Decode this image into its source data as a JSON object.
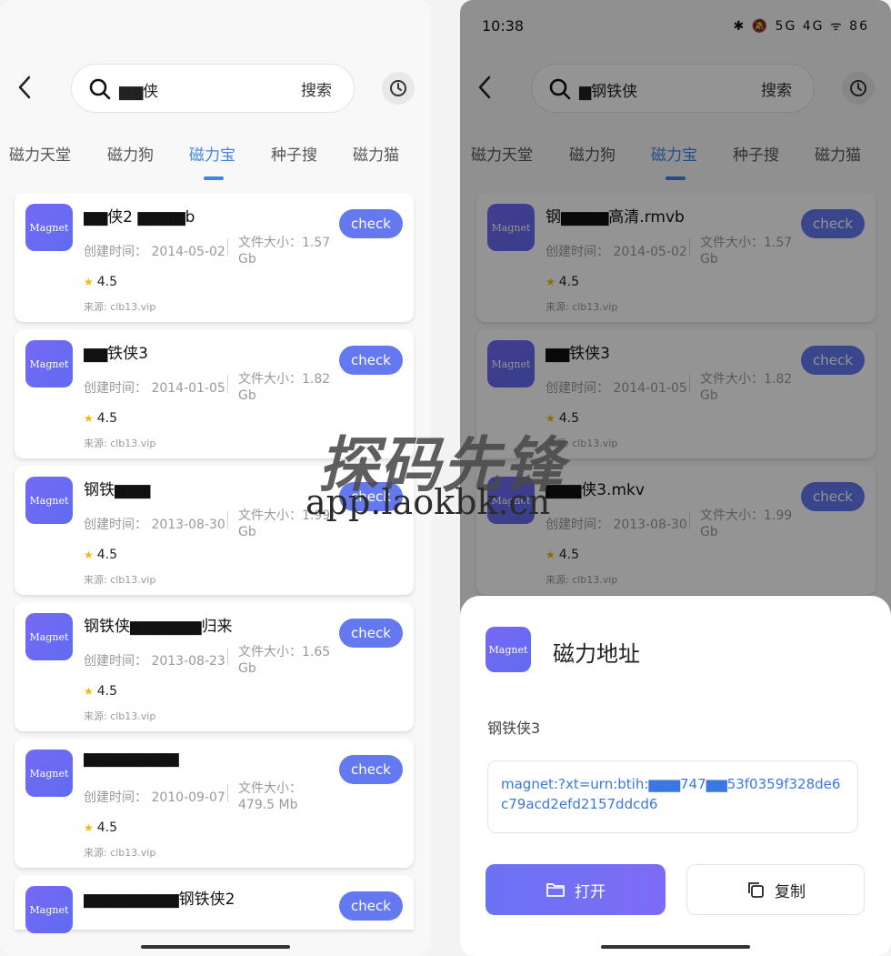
{
  "left": {
    "search": {
      "query": "▆▆侠",
      "button": "搜索"
    },
    "tabs": [
      "磁力天堂",
      "磁力狗",
      "磁力宝",
      "种子搜",
      "磁力猫"
    ],
    "active_tab": 2,
    "logo_text": "Magnet",
    "check_label": "check",
    "ctime_label": "创建时间：",
    "size_label": "文件大小：",
    "source_label": "来源: clb13.vip",
    "results": [
      {
        "title": "▆▆侠2 ▆▆▆▆b",
        "date": "2014-05-02",
        "size": "1.57 Gb",
        "rating": "4.5"
      },
      {
        "title": "▆▆铁侠3",
        "date": "2014-01-05",
        "size": "1.82 Gb",
        "rating": "4.5"
      },
      {
        "title": "钢铁▆▆▆",
        "date": "2013-08-30",
        "size": "1.99 Gb",
        "rating": "4.5"
      },
      {
        "title": "钢铁侠▆▆▆▆▆▆归来",
        "date": "2013-08-23",
        "size": "1.65 Gb",
        "rating": "4.5"
      },
      {
        "title": "▆▆▆▆▆▆▆▆",
        "date": "2010-09-07",
        "size": "479.5 Mb",
        "rating": "4.5"
      },
      {
        "title": "▆▆▆▆▆▆▆▆钢铁侠2"
      }
    ]
  },
  "right": {
    "status": {
      "time": "10:38",
      "icons": "✱ 🔕 5G 4G ᯤ 86"
    },
    "search": {
      "query": "▆钢铁侠",
      "button": "搜索"
    },
    "tabs": [
      "磁力天堂",
      "磁力狗",
      "磁力宝",
      "种子搜",
      "磁力猫"
    ],
    "active_tab": 2,
    "results": [
      {
        "title": "钢▆▆▆▆高清.rmvb",
        "date": "2014-05-02",
        "size": "1.57 Gb",
        "rating": "4.5"
      },
      {
        "title": "▆▆铁侠3",
        "date": "2014-01-05",
        "size": "1.82 Gb",
        "rating": "4.5"
      },
      {
        "title": "▆▆▆侠3.mkv",
        "date": "2013-08-30",
        "size": "1.99 Gb",
        "rating": "4.5"
      }
    ],
    "sheet": {
      "title": "磁力地址",
      "name": "钢铁侠3",
      "magnet": "magnet:?xt=urn:btih:▆▆▆747▆▆53f0359f328de6c79acd2efd2157ddcd6",
      "open_label": "打开",
      "copy_label": "复制"
    }
  },
  "watermark": {
    "title": "探码先锋",
    "url": "app.laokbk.cn"
  }
}
